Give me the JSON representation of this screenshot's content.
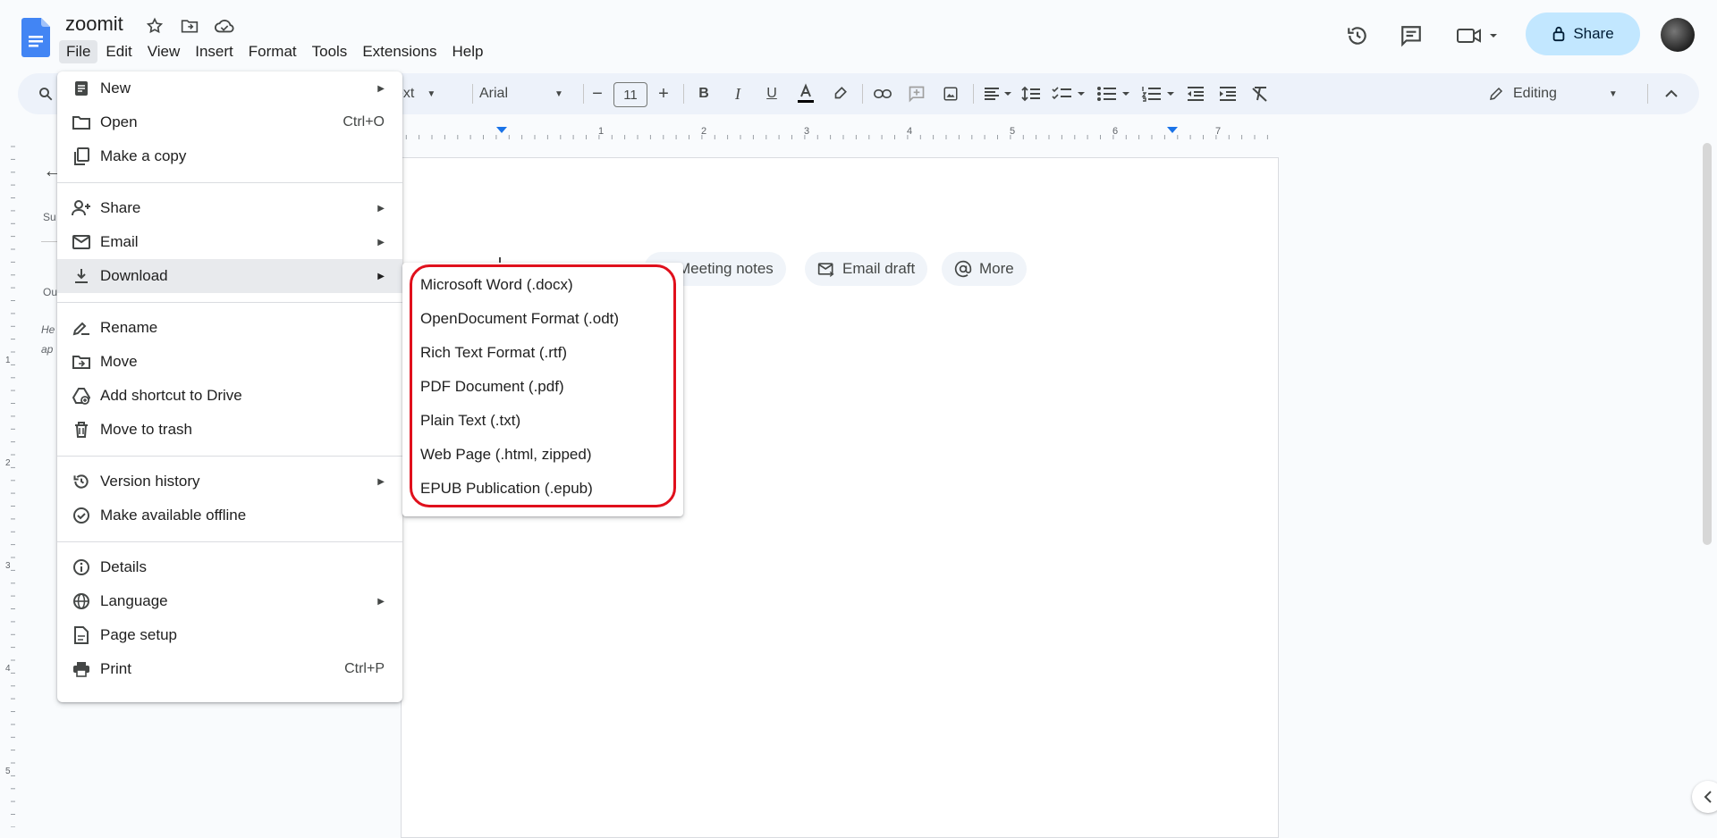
{
  "header": {
    "doc_title": "zoomit",
    "share_label": "Share"
  },
  "menubar": [
    "File",
    "Edit",
    "View",
    "Insert",
    "Format",
    "Tools",
    "Extensions",
    "Help"
  ],
  "toolbar": {
    "style_partial": "ext",
    "font": "Arial",
    "font_size": "11",
    "mode": "Editing"
  },
  "ruler_numbers": [
    "1",
    "2",
    "3",
    "4",
    "5",
    "6",
    "7"
  ],
  "vruler_numbers": [
    "1",
    "2",
    "3",
    "4",
    "5"
  ],
  "side_fragments": [
    "Su",
    "Ou",
    "He",
    "ap"
  ],
  "chips": [
    {
      "label": "Meeting notes",
      "icon": "notes-icon"
    },
    {
      "label": "Email draft",
      "icon": "email-draft-icon"
    },
    {
      "label": "More",
      "icon": "at-icon"
    }
  ],
  "file_menu": {
    "items": [
      {
        "label": "New",
        "icon": "doc-icon",
        "shortcut": "",
        "submenu": true
      },
      {
        "label": "Open",
        "icon": "folder-icon",
        "shortcut": "Ctrl+O",
        "submenu": false
      },
      {
        "label": "Make a copy",
        "icon": "copy-icon",
        "shortcut": "",
        "submenu": false
      },
      {
        "label": "Share",
        "icon": "person-add-icon",
        "shortcut": "",
        "submenu": true
      },
      {
        "label": "Email",
        "icon": "mail-icon",
        "shortcut": "",
        "submenu": true
      },
      {
        "label": "Download",
        "icon": "download-icon",
        "shortcut": "",
        "submenu": true
      },
      {
        "label": "Rename",
        "icon": "rename-icon",
        "shortcut": "",
        "submenu": false
      },
      {
        "label": "Move",
        "icon": "move-folder-icon",
        "shortcut": "",
        "submenu": false
      },
      {
        "label": "Add shortcut to Drive",
        "icon": "drive-shortcut-icon",
        "shortcut": "",
        "submenu": false
      },
      {
        "label": "Move to trash",
        "icon": "trash-icon",
        "shortcut": "",
        "submenu": false
      },
      {
        "label": "Version history",
        "icon": "history-icon",
        "shortcut": "",
        "submenu": true
      },
      {
        "label": "Make available offline",
        "icon": "offline-icon",
        "shortcut": "",
        "submenu": false
      },
      {
        "label": "Details",
        "icon": "info-icon",
        "shortcut": "",
        "submenu": false
      },
      {
        "label": "Language",
        "icon": "globe-icon",
        "shortcut": "",
        "submenu": true
      },
      {
        "label": "Page setup",
        "icon": "page-setup-icon",
        "shortcut": "",
        "submenu": false
      },
      {
        "label": "Print",
        "icon": "print-icon",
        "shortcut": "Ctrl+P",
        "submenu": false
      }
    ]
  },
  "download_menu": [
    "Microsoft Word (.docx)",
    "OpenDocument Format (.odt)",
    "Rich Text Format (.rtf)",
    "PDF Document (.pdf)",
    "Plain Text (.txt)",
    "Web Page (.html, zipped)",
    "EPUB Publication (.epub)"
  ],
  "colors": {
    "accent": "#1a73e8",
    "share_bg": "#c2e7ff",
    "highlight_border": "#e0101c"
  }
}
